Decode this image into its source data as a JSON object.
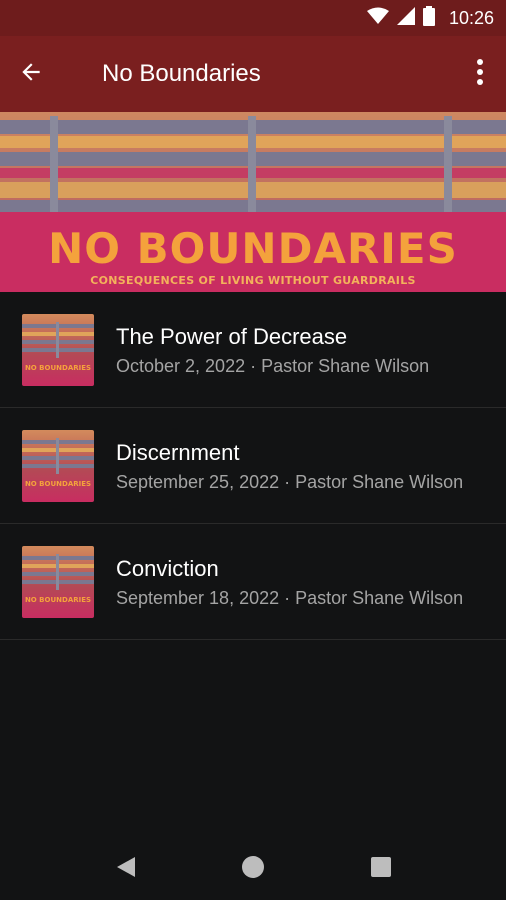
{
  "status_bar": {
    "time": "10:26",
    "icons": [
      "wifi-icon",
      "signal-icon",
      "battery-icon"
    ]
  },
  "app_bar": {
    "title": "No Boundaries",
    "back_icon": "arrow-left-icon",
    "menu_icon": "more-vert-icon"
  },
  "banner": {
    "title": "NO BOUNDARIES",
    "subtitle": "CONSEQUENCES OF LIVING WITHOUT GUARDRAILS"
  },
  "sermons": [
    {
      "title": "The Power of Decrease",
      "meta": "October 2, 2022 · Pastor Shane Wilson"
    },
    {
      "title": "Discernment",
      "meta": "September 25, 2022 · Pastor Shane Wilson"
    },
    {
      "title": "Conviction",
      "meta": "September 18, 2022 · Pastor Shane Wilson"
    }
  ],
  "thumbnail_text": "NO BOUNDARIES",
  "colors": {
    "status_bar": "#6e1c1c",
    "app_bar": "#7a1f1f",
    "background": "#121314",
    "banner_text": "#f4a23c",
    "meta_text": "#a4a4a4"
  },
  "nav": {
    "icons": [
      "back-triangle-icon",
      "home-circle-icon",
      "recents-square-icon"
    ]
  }
}
